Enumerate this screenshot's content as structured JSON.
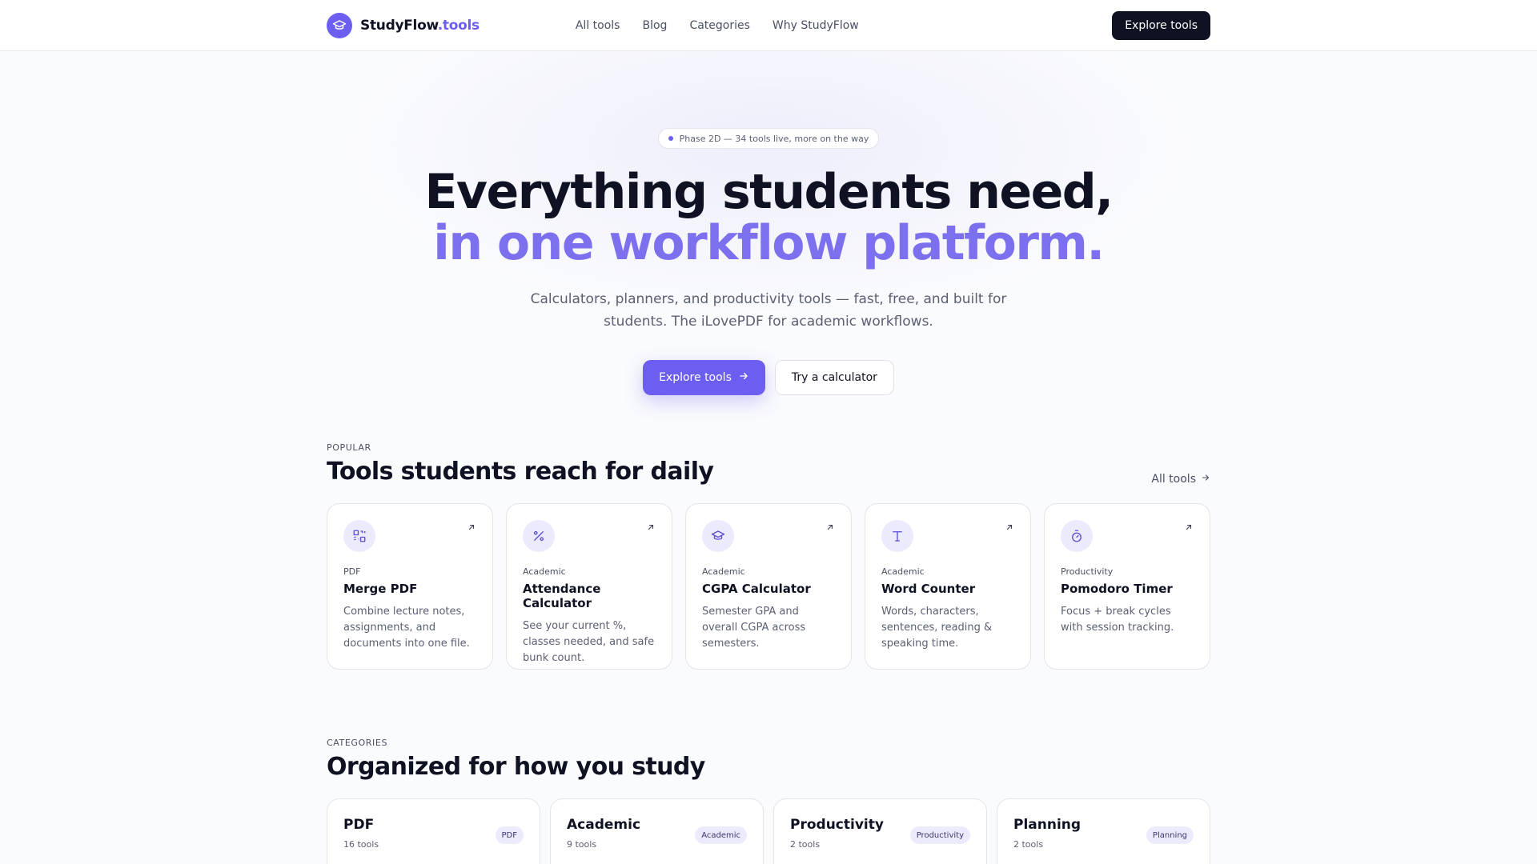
{
  "brand": {
    "name": "StudyFlow",
    "tld": ".tools"
  },
  "nav": [
    "All tools",
    "Blog",
    "Categories",
    "Why StudyFlow"
  ],
  "header_cta": "Explore tools",
  "hero": {
    "pill": "Phase 2D — 34 tools live, more on the way",
    "title_line1": "Everything students need,",
    "title_line2": "in one workflow platform.",
    "subtitle": "Calculators, planners, and productivity tools — fast, free, and built for students. The iLovePDF for academic workflows.",
    "primary_cta": "Explore tools",
    "secondary_cta": "Try a calculator"
  },
  "popular": {
    "eyebrow": "POPULAR",
    "title": "Tools students reach for daily",
    "all_link": "All tools",
    "tools": [
      {
        "category": "PDF",
        "title": "Merge PDF",
        "description": "Combine lecture notes, assignments, and documents into one file.",
        "icon": "merge-pdf-icon"
      },
      {
        "category": "Academic",
        "title": "Attendance Calculator",
        "description": "See your current %, classes needed, and safe bunk count.",
        "icon": "percent-icon"
      },
      {
        "category": "Academic",
        "title": "CGPA Calculator",
        "description": "Semester GPA and overall CGPA across semesters.",
        "icon": "graduation-cap-icon"
      },
      {
        "category": "Academic",
        "title": "Word Counter",
        "description": "Words, characters, sentences, reading & speaking time.",
        "icon": "text-icon"
      },
      {
        "category": "Productivity",
        "title": "Pomodoro Timer",
        "description": "Focus + break cycles with session tracking.",
        "icon": "timer-icon"
      }
    ]
  },
  "categories": {
    "eyebrow": "CATEGORIES",
    "title": "Organized for how you study",
    "items": [
      {
        "title": "PDF",
        "count": "16 tools",
        "badge": "PDF"
      },
      {
        "title": "Academic",
        "count": "9 tools",
        "badge": "Academic"
      },
      {
        "title": "Productivity",
        "count": "2 tools",
        "badge": "Productivity"
      },
      {
        "title": "Planning",
        "count": "2 tools",
        "badge": "Planning"
      }
    ]
  },
  "colors": {
    "accent": "#6b5ef0",
    "accent_light": "#7d70ef",
    "dark": "#0f1222"
  }
}
